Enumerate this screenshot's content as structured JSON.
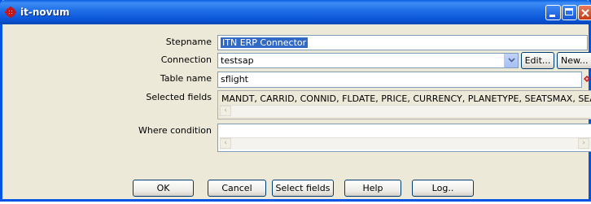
{
  "window": {
    "title": "it-novum",
    "accent_color": "#0054e3",
    "icon": "app-gear-icon"
  },
  "form": {
    "stepname_label": "Stepname",
    "stepname_value": "ITN ERP Connector",
    "connection_label": "Connection",
    "connection_value": "testsap",
    "edit_label": "Edit...",
    "new_label": "New...",
    "table_label": "Table name",
    "table_value": "sflight",
    "selected_fields_label": "Selected fields",
    "selected_fields_value": "MANDT, CARRID, CONNID, FLDATE, PRICE, CURRENCY, PLANETYPE, SEATSMAX, SEATSOCC,",
    "where_label": "Where condition",
    "where_value": ""
  },
  "buttons": {
    "ok": "OK",
    "cancel": "Cancel",
    "select_fields": "Select fields",
    "help": "Help",
    "log": "Log.."
  },
  "icons": {
    "left_arrow": "‹",
    "right_arrow": "›"
  }
}
